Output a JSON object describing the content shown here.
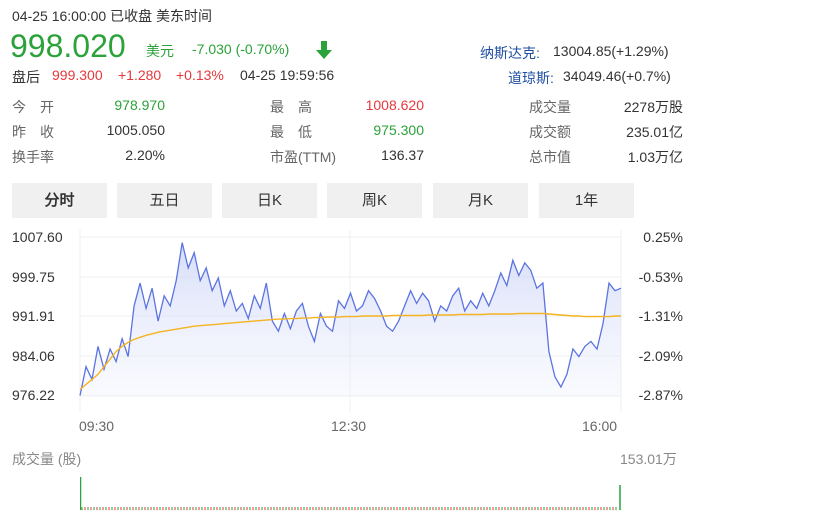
{
  "header": {
    "datetime_status": "04-25 16:00:00  已收盘  美东时间",
    "price": "998.020",
    "currency": "美元",
    "change": "-7.030 (-0.70%)",
    "after_hours": {
      "label": "盘后",
      "price": "999.300",
      "change": "+1.280",
      "percent": "+0.13%",
      "time": "04-25 19:59:56"
    }
  },
  "indices": [
    {
      "label": "纳斯达克:",
      "value": "13004.85(+1.29%)"
    },
    {
      "label": "道琼斯:",
      "value": "34049.46(+0.7%)"
    }
  ],
  "stats": [
    {
      "label": "今　开",
      "value": "978.970",
      "color": "#2ba23a"
    },
    {
      "label": "最　高",
      "value": "1008.620",
      "color": "#e4393c"
    },
    {
      "label": "成交量",
      "value": "2278万股",
      "color": "#333333"
    },
    {
      "label": "昨　收",
      "value": "1005.050",
      "color": "#333333"
    },
    {
      "label": "最　低",
      "value": "975.300",
      "color": "#2ba23a"
    },
    {
      "label": "成交额",
      "value": "235.01亿",
      "color": "#333333"
    },
    {
      "label": "换手率",
      "value": "2.20%",
      "color": "#333333"
    },
    {
      "label": "市盈(TTM)",
      "value": "136.37",
      "color": "#333333"
    },
    {
      "label": "总市值",
      "value": "1.03万亿",
      "color": "#333333"
    }
  ],
  "tabs": [
    "分时",
    "五日",
    "日K",
    "周K",
    "月K",
    "1年"
  ],
  "active_tab": "分时",
  "colors": {
    "up": "#e4393c",
    "down": "#2ba23a",
    "price_line": "#5b74e0",
    "avg_line": "#f5b31f",
    "index_link": "#1f4ea1"
  },
  "chart_data": {
    "type": "line",
    "title": "",
    "price_axis_ticks": [
      "1007.60",
      "999.75",
      "991.91",
      "984.06",
      "976.22"
    ],
    "percent_axis_ticks": [
      "0.25%",
      "-0.53%",
      "-1.31%",
      "-2.09%",
      "-2.87%"
    ],
    "time_ticks": [
      "09:30",
      "12:30",
      "16:00"
    ],
    "ylim": [
      976.22,
      1007.6
    ],
    "prev_close": 1005.05,
    "series": [
      {
        "values": [
          976.3,
          982.0,
          979.5,
          986.0,
          981.5,
          985.5,
          983.0,
          987.5,
          984.0,
          994.0,
          998.5,
          993.5,
          997.5,
          991.0,
          996.0,
          994.0,
          999.0,
          1006.5,
          1001.5,
          1004.5,
          999.0,
          1001.5,
          997.0,
          999.5,
          994.0,
          997.0,
          993.0,
          994.5,
          991.5,
          996.0,
          993.5,
          998.5,
          991.0,
          989.0,
          992.5,
          989.5,
          993.0,
          994.5,
          990.0,
          987.0,
          992.5,
          990.0,
          989.0,
          995.0,
          993.5,
          996.5,
          993.0,
          994.0,
          997.0,
          995.5,
          993.0,
          990.0,
          989.0,
          991.0,
          994.0,
          997.0,
          994.5,
          996.5,
          995.0,
          991.0,
          994.0,
          993.0,
          996.0,
          997.5,
          993.0,
          995.0,
          993.5,
          996.5,
          994.0,
          997.0,
          1000.5,
          998.0,
          1003.0,
          1000.0,
          1002.5,
          1001.0,
          997.5,
          998.5,
          985.0,
          980.0,
          978.0,
          980.5,
          985.5,
          984.0,
          986.0,
          987.0,
          985.5,
          990.5,
          998.5,
          997.0,
          997.5
        ]
      },
      {
        "values": [
          977.5,
          978.5,
          979.5,
          980.5,
          982.0,
          983.5,
          985.0,
          986.0,
          986.8,
          987.4,
          987.8,
          988.2,
          988.5,
          988.8,
          989.0,
          989.2,
          989.4,
          989.6,
          989.8,
          990.0,
          990.1,
          990.2,
          990.3,
          990.4,
          990.5,
          990.6,
          990.7,
          990.8,
          990.9,
          991.0,
          991.1,
          991.2,
          991.3,
          991.4,
          991.4,
          991.5,
          991.5,
          991.6,
          991.6,
          991.7,
          991.7,
          991.8,
          991.8,
          991.8,
          991.9,
          991.9,
          991.9,
          992.0,
          992.0,
          992.0,
          992.0,
          992.0,
          992.1,
          992.1,
          992.1,
          992.1,
          992.1,
          992.1,
          992.2,
          992.2,
          992.2,
          992.2,
          992.2,
          992.3,
          992.3,
          992.3,
          992.3,
          992.3,
          992.4,
          992.4,
          992.4,
          992.4,
          992.4,
          992.5,
          992.5,
          992.5,
          992.5,
          992.5,
          992.4,
          992.3,
          992.2,
          992.1,
          992.0,
          992.0,
          991.9,
          991.9,
          991.9,
          991.9,
          991.9,
          992.0,
          992.0
        ]
      }
    ]
  },
  "volume": {
    "title": "成交量 (股)",
    "max_label": "153.01万"
  }
}
